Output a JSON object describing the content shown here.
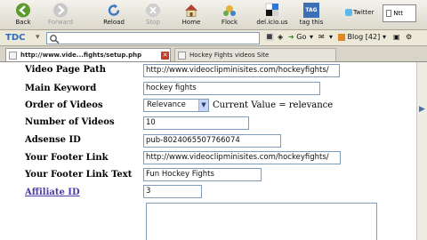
{
  "nav": {
    "back": "Back",
    "forward": "Forward",
    "reload": "Reload",
    "stop": "Stop",
    "home": "Home",
    "flock": "Flock",
    "delicious": "del.icio.us",
    "tag_this": "tag this",
    "twitter": "Twitter",
    "tag_badge": "TAG"
  },
  "toolbar": {
    "logo": "TDC",
    "go": "Go",
    "blog": "Blog [42]"
  },
  "tabs": [
    {
      "label": "http://www.vide...fights/setup.php"
    },
    {
      "label": "Hockey Fights videos Site"
    }
  ],
  "form": {
    "video_page_path": {
      "label": "Video Page Path",
      "value": "http://www.videoclipminisites.com/hockeyfights/"
    },
    "main_keyword": {
      "label": "Main Keyword",
      "value": "hockey fights"
    },
    "order_of_videos": {
      "label": "Order of Videos",
      "value": "Relevance",
      "note": "Current Value = relevance"
    },
    "number_of_videos": {
      "label": "Number of Videos",
      "value": "10"
    },
    "adsense_id": {
      "label": "Adsense ID",
      "value": "pub-8024065507766074"
    },
    "footer_link": {
      "label": "Your Footer Link",
      "value": "http://www.videoclipminisites.com/hockeyfights/"
    },
    "footer_link_text": {
      "label": "Your Footer Link Text",
      "value": "Fun Hockey Fights"
    },
    "affiliate_id": {
      "label": "Affiliate ID",
      "value": "3"
    }
  }
}
